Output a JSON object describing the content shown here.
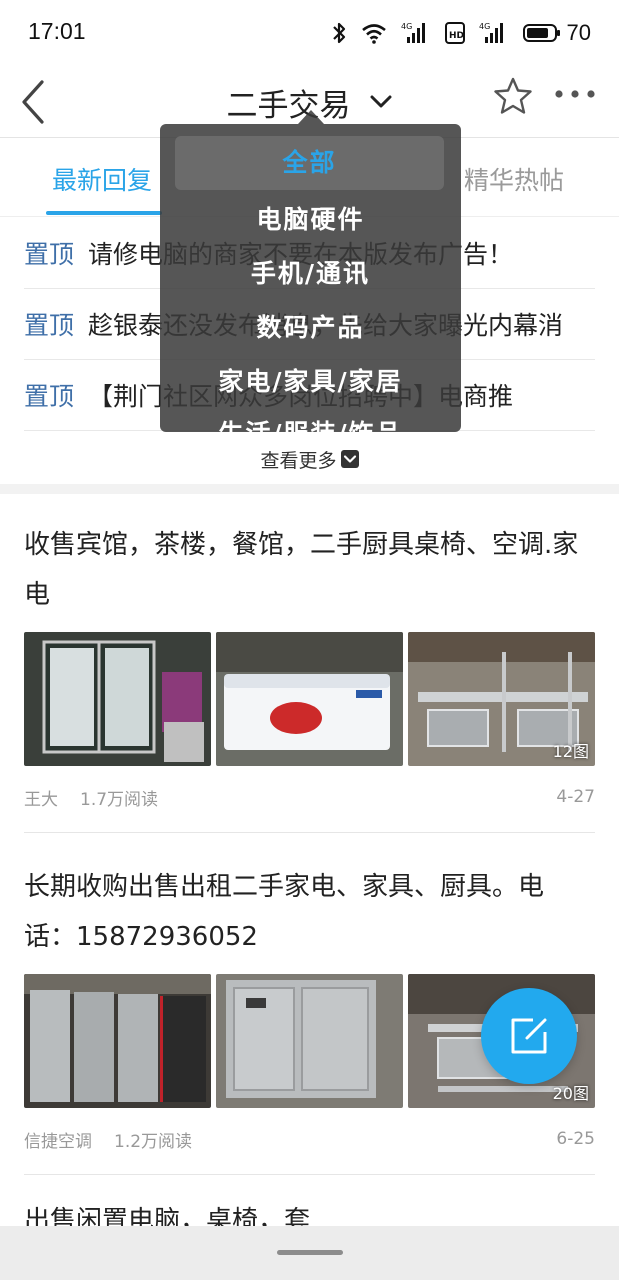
{
  "status_bar": {
    "time": "17:01",
    "battery": "70"
  },
  "nav": {
    "title": "二手交易"
  },
  "tabs": {
    "latest": "最新回复",
    "featured": "精华热帖"
  },
  "dropdown": {
    "items": [
      "全部",
      "电脑硬件",
      "手机/通讯",
      "数码产品",
      "家电/家具/家居",
      "生活/服装/饰品"
    ],
    "selected": "全部"
  },
  "pinned": {
    "tag": "置顶",
    "items": [
      "请修电脑的商家不要在本版发布广告！",
      "趁银泰还没发布消息，先给大家曝光内幕消",
      "【荆门社区网众多岗位招聘中】电商推"
    ],
    "see_more": "查看更多"
  },
  "posts": [
    {
      "title": "收售宾馆，茶楼，餐馆，二手厨具桌椅、空调.家电",
      "author": "王大",
      "reads": "1.7万阅读",
      "date": "4-27",
      "image_count": "12图"
    },
    {
      "title": "长期收购出售出租二手家电、家具、厨具。电话：15872936052",
      "author": "信捷空调",
      "reads": "1.2万阅读",
      "date": "6-25",
      "image_count": "20图"
    },
    {
      "title": "出售闲置电脑，桌椅，套"
    }
  ],
  "colors": {
    "accent": "#2aa4e8",
    "pinned_tag": "#3f6fa8",
    "fab": "#22a9ee"
  }
}
